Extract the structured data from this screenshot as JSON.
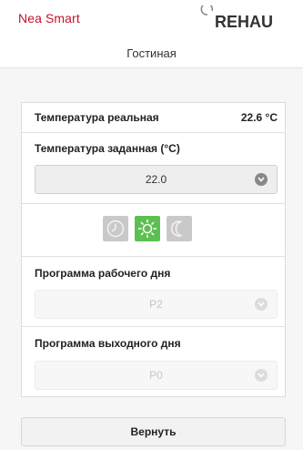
{
  "header": {
    "brand": "Nea Smart",
    "logo_text": "REHAU"
  },
  "room": {
    "title": "Гостиная"
  },
  "panel": {
    "actual_temp_label": "Температура реальная",
    "actual_temp_value": "22.6 °C",
    "set_temp_label": "Температура заданная (°C)",
    "set_temp_value": "22.0",
    "modes": [
      {
        "name": "clock-icon",
        "active": false
      },
      {
        "name": "sun-icon",
        "active": true
      },
      {
        "name": "moon-icon",
        "active": false
      }
    ],
    "workday_label": "Программа рабочего дня",
    "workday_value": "P2",
    "weekend_label": "Программа выходного дня",
    "weekend_value": "P0"
  },
  "actions": {
    "reset_label": "Вернуть"
  },
  "colors": {
    "brand_red": "#c8102e",
    "mode_active": "#5dbf52",
    "mode_inactive": "#c9c9c9"
  }
}
